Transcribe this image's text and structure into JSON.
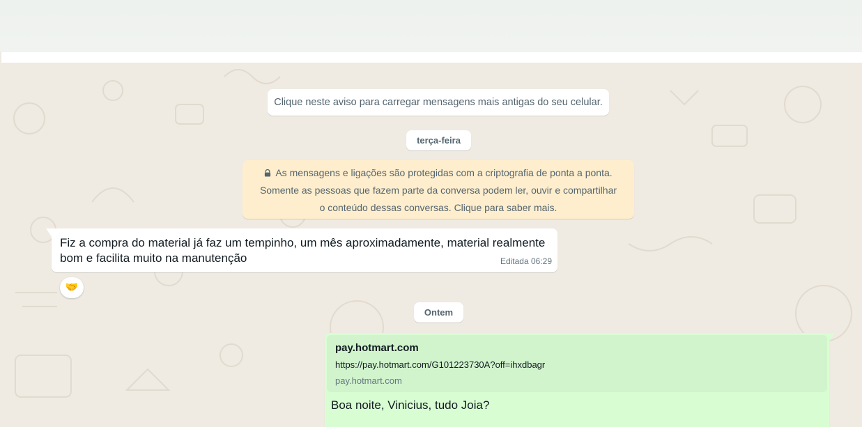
{
  "chat": {
    "load_older_notice": "Clique neste aviso para carregar mensagens mais antigas do seu celular.",
    "date_separators": [
      "terça-feira",
      "Ontem"
    ],
    "encryption_notice": {
      "line1": "As mensagens e ligações são protegidas com a criptografia de ponta a ponta.",
      "line2": "Somente as pessoas que fazem parte da conversa podem ler, ouvir e compartilhar",
      "line3": "o conteúdo dessas conversas. Clique para saber mais."
    },
    "incoming_message": {
      "line1": "Fiz a compra do material já faz um tempinho, um mês aproximadamente, material realmente",
      "line2": "bom e facilita muito na manutenção",
      "meta": "Editada 06:29",
      "reaction": "🤝"
    },
    "outgoing_message": {
      "link_preview": {
        "title": "pay.hotmart.com",
        "url": "https://pay.hotmart.com/G101223730A?off=ihxdbagr",
        "domain": "pay.hotmart.com"
      },
      "text": "Boa noite, Vinicius, tudo Joia?"
    }
  },
  "colors": {
    "wallpaper": "#efeae2",
    "incoming_bubble": "#ffffff",
    "outgoing_bubble": "#d9fdd3",
    "encryption_bubble": "#ffeecd",
    "secondary_text": "#54656f"
  }
}
